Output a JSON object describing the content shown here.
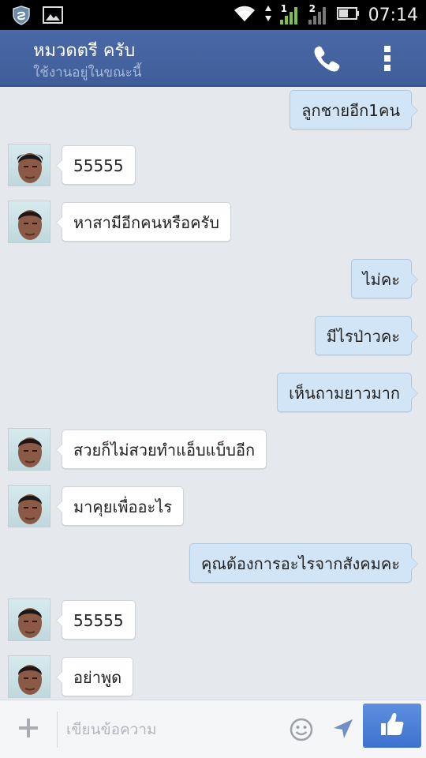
{
  "status_bar": {
    "time": "07:14",
    "sim1": "1",
    "sim2": "2",
    "icons": [
      "shield-app-icon",
      "gallery-icon",
      "wifi-icon",
      "signal-icon",
      "battery-icon"
    ]
  },
  "header": {
    "contact_name": "หมวดตรี ครับ",
    "status": "ใช้งานอยู่ในขณะนี้",
    "call_icon": "phone-icon",
    "more_icon": "vertical-dots-icon"
  },
  "messages": [
    {
      "from": "me",
      "text": "ลูกชายอีก1คน"
    },
    {
      "from": "contact",
      "text": "55555"
    },
    {
      "from": "contact",
      "text": "หาสามีอีกคนหรือครับ"
    },
    {
      "from": "me",
      "text": "ไม่คะ"
    },
    {
      "from": "me",
      "text": "มีไรป่าวคะ"
    },
    {
      "from": "me",
      "text": "เห็นถามยาวมาก"
    },
    {
      "from": "contact",
      "text": "สวยก็ไม่สวยทำแอ็บแบ็บอีก"
    },
    {
      "from": "contact",
      "text": "มาคุยเพื่ออะไร"
    },
    {
      "from": "me",
      "text": "คุณต้องการอะไรจากสังคมคะ"
    },
    {
      "from": "contact",
      "text": "55555"
    },
    {
      "from": "contact",
      "text": "อย่าพูด"
    }
  ],
  "composer": {
    "placeholder": "เขียนข้อความ",
    "icons": [
      "plus-icon",
      "emoji-icon",
      "location-arrow-icon",
      "thumbs-up-icon"
    ]
  },
  "colors": {
    "header_bg": "#4563a0",
    "chat_bg": "#e5e9ee",
    "outgoing_bubble": "#d2e5f7",
    "incoming_bubble": "#ffffff",
    "like_button": "#4a7fd8"
  }
}
